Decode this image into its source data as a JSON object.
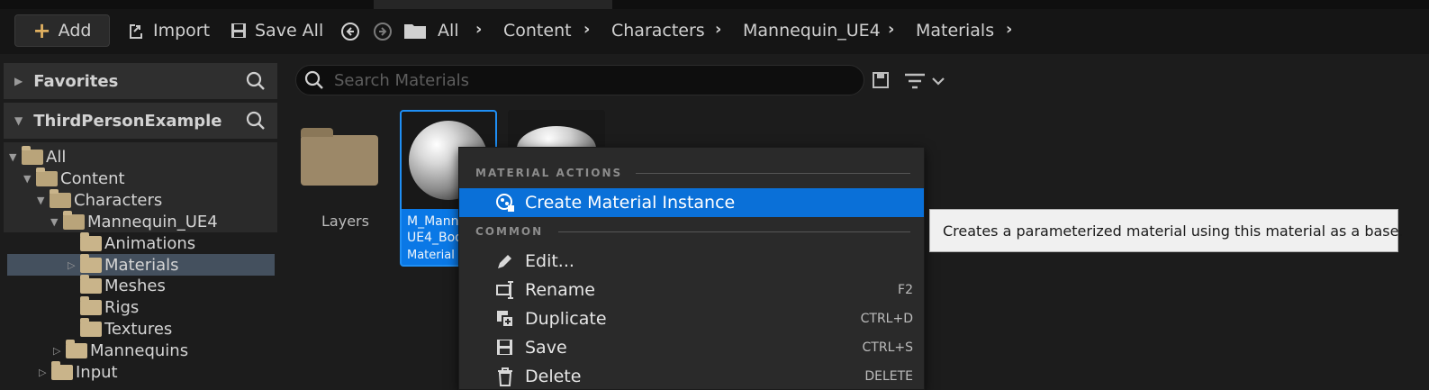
{
  "toolbar": {
    "add_label": "Add",
    "import_label": "Import",
    "save_all_label": "Save All"
  },
  "breadcrumb": [
    "All",
    "Content",
    "Characters",
    "Mannequin_UE4",
    "Materials"
  ],
  "sidebar": {
    "favorites_label": "Favorites",
    "project_label": "ThirdPersonExample",
    "tree": [
      {
        "label": "All"
      },
      {
        "label": "Content"
      },
      {
        "label": "Characters"
      },
      {
        "label": "Mannequin_UE4"
      },
      {
        "label": "Animations"
      },
      {
        "label": "Materials"
      },
      {
        "label": "Meshes"
      },
      {
        "label": "Rigs"
      },
      {
        "label": "Textures"
      },
      {
        "label": "Mannequins"
      },
      {
        "label": "Input"
      }
    ]
  },
  "search": {
    "placeholder": "Search Materials"
  },
  "assets": {
    "folder_label": "Layers",
    "material_name_line1": "M_Mann",
    "material_name_line2": "UE4_Bod",
    "material_type": "Material"
  },
  "context_menu": {
    "section_material": "MATERIAL ACTIONS",
    "section_common": "COMMON",
    "items": [
      {
        "label": "Create Material Instance",
        "shortcut": ""
      },
      {
        "label": "Edit...",
        "shortcut": ""
      },
      {
        "label": "Rename",
        "shortcut": "F2"
      },
      {
        "label": "Duplicate",
        "shortcut": "CTRL+D"
      },
      {
        "label": "Save",
        "shortcut": "CTRL+S"
      },
      {
        "label": "Delete",
        "shortcut": "DELETE"
      }
    ]
  },
  "tooltip": "Creates a parameterized material using this material as a base.",
  "colors": {
    "highlight": "#0a70d8",
    "selection": "#44505e",
    "folder": "#c9b48a"
  }
}
